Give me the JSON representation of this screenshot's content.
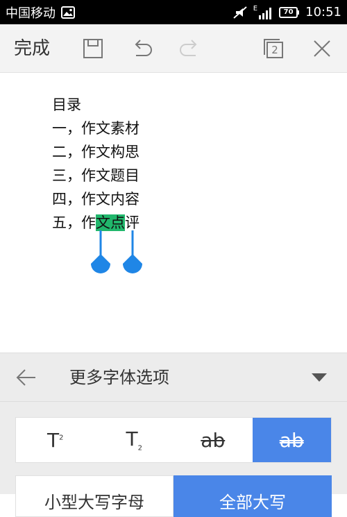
{
  "status_bar": {
    "carrier": "中国移动",
    "battery": "70",
    "time": "10:51",
    "network_label": "E",
    "icons": [
      "image-icon",
      "mute-icon",
      "signal-icon",
      "battery-icon"
    ]
  },
  "toolbar": {
    "done_label": "完成",
    "page_count": "2",
    "icons": [
      "save-icon",
      "undo-icon",
      "redo-icon",
      "pages-icon",
      "close-icon"
    ]
  },
  "document": {
    "lines": [
      {
        "pre": "目录",
        "sel": "",
        "post": ""
      },
      {
        "pre": "一，作文素材",
        "sel": "",
        "post": ""
      },
      {
        "pre": "二，作文构思",
        "sel": "",
        "post": ""
      },
      {
        "pre": "三，作文题目",
        "sel": "",
        "post": ""
      },
      {
        "pre": "四，作文内容",
        "sel": "",
        "post": ""
      },
      {
        "pre": "五，作",
        "sel": "文点",
        "post": "评"
      }
    ]
  },
  "panel": {
    "title": "更多字体选项",
    "format_buttons": [
      {
        "label": "T",
        "mark": "2",
        "kind": "superscript"
      },
      {
        "label": "T",
        "mark": "2",
        "kind": "subscript"
      },
      {
        "label": "ab",
        "kind": "strikethrough"
      },
      {
        "label": "ab",
        "kind": "double-strikethrough",
        "active": true
      }
    ],
    "case_buttons": [
      {
        "label": "小型大写字母"
      },
      {
        "label": "全部大写",
        "active": true
      }
    ]
  },
  "colors": {
    "accent": "#4a86e8",
    "selection": "#21b76c",
    "handle": "#1f86e6"
  }
}
